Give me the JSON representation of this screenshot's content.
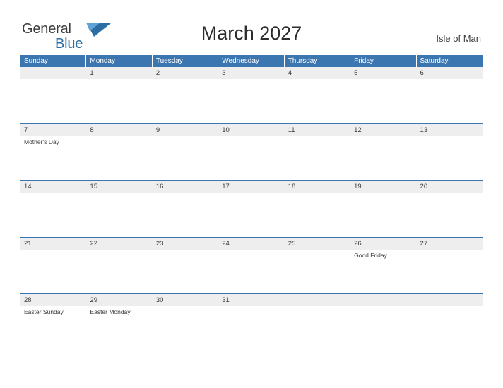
{
  "logo": {
    "general": "General",
    "blue": "Blue",
    "flag_icon": "flag-icon"
  },
  "header": {
    "title": "March 2027",
    "region": "Isle of Man"
  },
  "calendar": {
    "day_headers": [
      "Sunday",
      "Monday",
      "Tuesday",
      "Wednesday",
      "Thursday",
      "Friday",
      "Saturday"
    ],
    "weeks": [
      [
        {
          "day": "",
          "events": []
        },
        {
          "day": "1",
          "events": []
        },
        {
          "day": "2",
          "events": []
        },
        {
          "day": "3",
          "events": []
        },
        {
          "day": "4",
          "events": []
        },
        {
          "day": "5",
          "events": []
        },
        {
          "day": "6",
          "events": []
        }
      ],
      [
        {
          "day": "7",
          "events": [
            "Mother's Day"
          ]
        },
        {
          "day": "8",
          "events": []
        },
        {
          "day": "9",
          "events": []
        },
        {
          "day": "10",
          "events": []
        },
        {
          "day": "11",
          "events": []
        },
        {
          "day": "12",
          "events": []
        },
        {
          "day": "13",
          "events": []
        }
      ],
      [
        {
          "day": "14",
          "events": []
        },
        {
          "day": "15",
          "events": []
        },
        {
          "day": "16",
          "events": []
        },
        {
          "day": "17",
          "events": []
        },
        {
          "day": "18",
          "events": []
        },
        {
          "day": "19",
          "events": []
        },
        {
          "day": "20",
          "events": []
        }
      ],
      [
        {
          "day": "21",
          "events": []
        },
        {
          "day": "22",
          "events": []
        },
        {
          "day": "23",
          "events": []
        },
        {
          "day": "24",
          "events": []
        },
        {
          "day": "25",
          "events": []
        },
        {
          "day": "26",
          "events": [
            "Good Friday"
          ]
        },
        {
          "day": "27",
          "events": []
        }
      ],
      [
        {
          "day": "28",
          "events": [
            "Easter Sunday"
          ]
        },
        {
          "day": "29",
          "events": [
            "Easter Monday"
          ]
        },
        {
          "day": "30",
          "events": []
        },
        {
          "day": "31",
          "events": []
        },
        {
          "day": "",
          "events": []
        },
        {
          "day": "",
          "events": []
        },
        {
          "day": "",
          "events": []
        }
      ]
    ]
  },
  "colors": {
    "header_blue": "#3b76b0",
    "strip_gray": "#eeeeee",
    "logo_blue": "#2b6ca3"
  }
}
